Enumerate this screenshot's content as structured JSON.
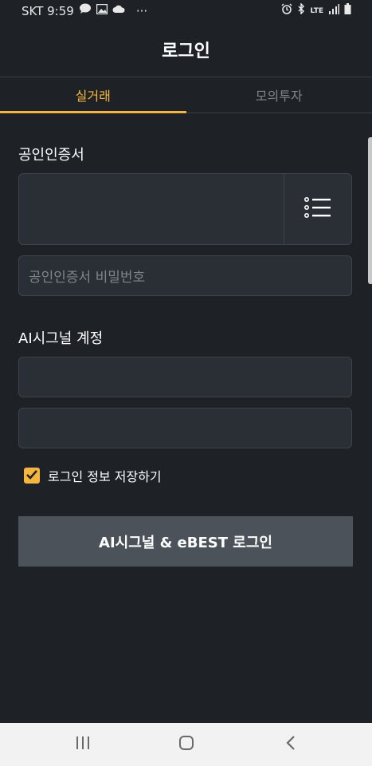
{
  "status_bar": {
    "carrier_time": "SKT 9:59",
    "more": "···",
    "network": "LTE"
  },
  "header": {
    "title": "로그인"
  },
  "tabs": [
    {
      "label": "실거래",
      "active": true
    },
    {
      "label": "모의투자",
      "active": false
    }
  ],
  "certificate": {
    "section_label": "공인인증서",
    "password_placeholder": "공인인증서 비밀번호"
  },
  "account": {
    "section_label": "AI시그널 계정",
    "id_value": "",
    "pw_value": ""
  },
  "remember": {
    "label": "로그인 정보 저장하기",
    "checked": true
  },
  "login_button": {
    "label": "AI시그널 & eBEST 로그인"
  },
  "colors": {
    "accent": "#f4b63f",
    "background": "#1e2227",
    "field": "#2a2e35",
    "button": "#4b5259"
  },
  "icons": {
    "cert_list": "list-icon",
    "nav_recent": "recent-apps-icon",
    "nav_home": "home-icon",
    "nav_back": "back-icon"
  }
}
